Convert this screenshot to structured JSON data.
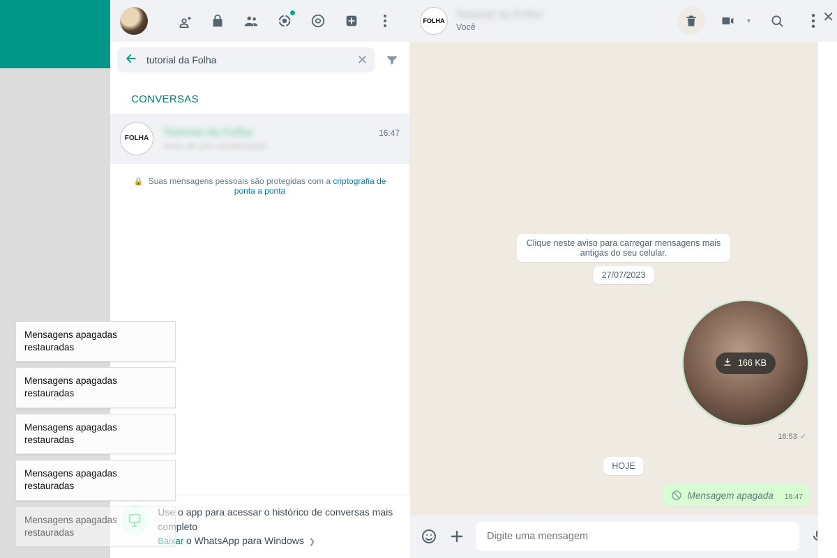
{
  "colors": {
    "teal": "#009688",
    "accent": "#00a884",
    "green_bubble": "#d9fdd3"
  },
  "left_notifications": [
    {
      "line1": "Mensagens apagadas",
      "line2": "restauradas",
      "dim": false
    },
    {
      "line1": "Mensagens apagadas",
      "line2": "restauradas",
      "dim": false
    },
    {
      "line1": "Mensagens apagadas",
      "line2": "restauradas",
      "dim": false
    },
    {
      "line1": "Mensagens apagadas",
      "line2": "restauradas",
      "dim": false
    },
    {
      "line1": "Mensagens apagadas",
      "line2": "restauradas",
      "dim": true
    }
  ],
  "list": {
    "search_value": "tutorial da Folha",
    "section_label": "CONVERSAS",
    "encryption_note_prefix": "Suas mensagens pessoais são protegidas com a ",
    "encryption_note_link": "criptografia de ponta a ponta",
    "chats": [
      {
        "avatar_text": "FOLHA",
        "title_blur": "Tutorial da Folha",
        "preview_blur": "texto de pré-visualização",
        "time": "16:47"
      }
    ]
  },
  "app_banner": {
    "line1": "Use o app para acessar o histórico de conversas mais completo",
    "download_word": "Baixar",
    "download_rest": " o WhatsApp para Windows"
  },
  "conversation": {
    "header": {
      "avatar_text": "FOLHA",
      "title_blur": "Tutorial da Folha",
      "subtitle": "Você"
    },
    "load_notice": "Clique neste aviso para carregar mensagens mais antigas do seu celular.",
    "date1": "27/07/2023",
    "date2": "HOJE",
    "media": {
      "size_label": "166 KB",
      "time": "16:53"
    },
    "deleted": {
      "text": "Mensagem apagada",
      "time": "16:47"
    },
    "composer_placeholder": "Digite uma mensagem"
  },
  "icons": {
    "new_chat": "new-chat-icon",
    "lock": "lock-icon",
    "communities": "communities-icon",
    "status": "status-icon",
    "channels": "channels-icon",
    "add_box": "new-icon",
    "menu": "menu-icon",
    "back": "back-arrow-icon",
    "clear": "clear-icon",
    "filter": "filter-icon",
    "delete": "delete-icon",
    "video": "video-call-icon",
    "search": "search-icon",
    "emoji": "emoji-icon",
    "attach": "attach-icon",
    "mic": "mic-icon",
    "download": "download-icon",
    "ban": "ban-icon",
    "check": "single-check-icon"
  }
}
